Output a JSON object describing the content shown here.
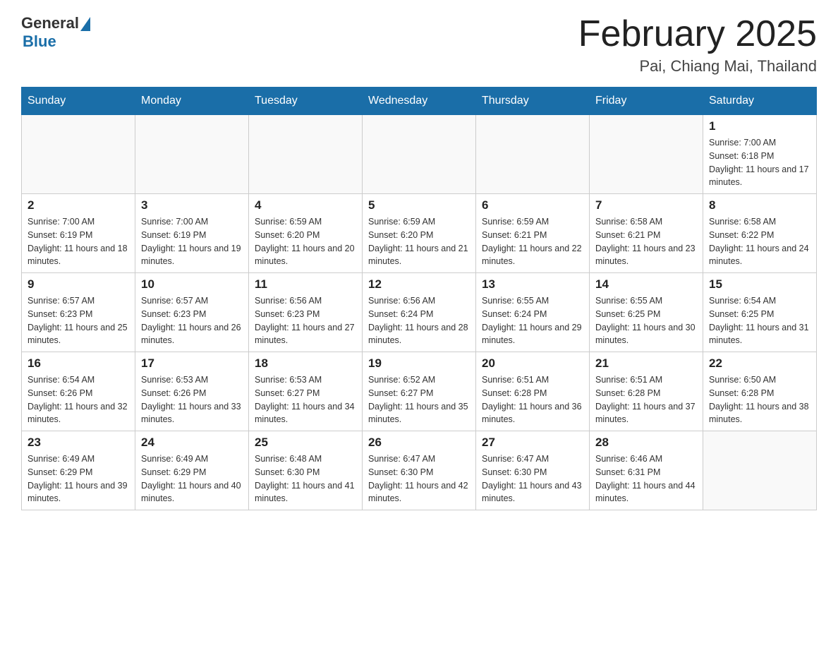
{
  "header": {
    "logo_general": "General",
    "logo_blue": "Blue",
    "month_title": "February 2025",
    "location": "Pai, Chiang Mai, Thailand"
  },
  "weekdays": [
    "Sunday",
    "Monday",
    "Tuesday",
    "Wednesday",
    "Thursday",
    "Friday",
    "Saturday"
  ],
  "weeks": [
    [
      {
        "day": "",
        "sunrise": "",
        "sunset": "",
        "daylight": ""
      },
      {
        "day": "",
        "sunrise": "",
        "sunset": "",
        "daylight": ""
      },
      {
        "day": "",
        "sunrise": "",
        "sunset": "",
        "daylight": ""
      },
      {
        "day": "",
        "sunrise": "",
        "sunset": "",
        "daylight": ""
      },
      {
        "day": "",
        "sunrise": "",
        "sunset": "",
        "daylight": ""
      },
      {
        "day": "",
        "sunrise": "",
        "sunset": "",
        "daylight": ""
      },
      {
        "day": "1",
        "sunrise": "Sunrise: 7:00 AM",
        "sunset": "Sunset: 6:18 PM",
        "daylight": "Daylight: 11 hours and 17 minutes."
      }
    ],
    [
      {
        "day": "2",
        "sunrise": "Sunrise: 7:00 AM",
        "sunset": "Sunset: 6:19 PM",
        "daylight": "Daylight: 11 hours and 18 minutes."
      },
      {
        "day": "3",
        "sunrise": "Sunrise: 7:00 AM",
        "sunset": "Sunset: 6:19 PM",
        "daylight": "Daylight: 11 hours and 19 minutes."
      },
      {
        "day": "4",
        "sunrise": "Sunrise: 6:59 AM",
        "sunset": "Sunset: 6:20 PM",
        "daylight": "Daylight: 11 hours and 20 minutes."
      },
      {
        "day": "5",
        "sunrise": "Sunrise: 6:59 AM",
        "sunset": "Sunset: 6:20 PM",
        "daylight": "Daylight: 11 hours and 21 minutes."
      },
      {
        "day": "6",
        "sunrise": "Sunrise: 6:59 AM",
        "sunset": "Sunset: 6:21 PM",
        "daylight": "Daylight: 11 hours and 22 minutes."
      },
      {
        "day": "7",
        "sunrise": "Sunrise: 6:58 AM",
        "sunset": "Sunset: 6:21 PM",
        "daylight": "Daylight: 11 hours and 23 minutes."
      },
      {
        "day": "8",
        "sunrise": "Sunrise: 6:58 AM",
        "sunset": "Sunset: 6:22 PM",
        "daylight": "Daylight: 11 hours and 24 minutes."
      }
    ],
    [
      {
        "day": "9",
        "sunrise": "Sunrise: 6:57 AM",
        "sunset": "Sunset: 6:23 PM",
        "daylight": "Daylight: 11 hours and 25 minutes."
      },
      {
        "day": "10",
        "sunrise": "Sunrise: 6:57 AM",
        "sunset": "Sunset: 6:23 PM",
        "daylight": "Daylight: 11 hours and 26 minutes."
      },
      {
        "day": "11",
        "sunrise": "Sunrise: 6:56 AM",
        "sunset": "Sunset: 6:23 PM",
        "daylight": "Daylight: 11 hours and 27 minutes."
      },
      {
        "day": "12",
        "sunrise": "Sunrise: 6:56 AM",
        "sunset": "Sunset: 6:24 PM",
        "daylight": "Daylight: 11 hours and 28 minutes."
      },
      {
        "day": "13",
        "sunrise": "Sunrise: 6:55 AM",
        "sunset": "Sunset: 6:24 PM",
        "daylight": "Daylight: 11 hours and 29 minutes."
      },
      {
        "day": "14",
        "sunrise": "Sunrise: 6:55 AM",
        "sunset": "Sunset: 6:25 PM",
        "daylight": "Daylight: 11 hours and 30 minutes."
      },
      {
        "day": "15",
        "sunrise": "Sunrise: 6:54 AM",
        "sunset": "Sunset: 6:25 PM",
        "daylight": "Daylight: 11 hours and 31 minutes."
      }
    ],
    [
      {
        "day": "16",
        "sunrise": "Sunrise: 6:54 AM",
        "sunset": "Sunset: 6:26 PM",
        "daylight": "Daylight: 11 hours and 32 minutes."
      },
      {
        "day": "17",
        "sunrise": "Sunrise: 6:53 AM",
        "sunset": "Sunset: 6:26 PM",
        "daylight": "Daylight: 11 hours and 33 minutes."
      },
      {
        "day": "18",
        "sunrise": "Sunrise: 6:53 AM",
        "sunset": "Sunset: 6:27 PM",
        "daylight": "Daylight: 11 hours and 34 minutes."
      },
      {
        "day": "19",
        "sunrise": "Sunrise: 6:52 AM",
        "sunset": "Sunset: 6:27 PM",
        "daylight": "Daylight: 11 hours and 35 minutes."
      },
      {
        "day": "20",
        "sunrise": "Sunrise: 6:51 AM",
        "sunset": "Sunset: 6:28 PM",
        "daylight": "Daylight: 11 hours and 36 minutes."
      },
      {
        "day": "21",
        "sunrise": "Sunrise: 6:51 AM",
        "sunset": "Sunset: 6:28 PM",
        "daylight": "Daylight: 11 hours and 37 minutes."
      },
      {
        "day": "22",
        "sunrise": "Sunrise: 6:50 AM",
        "sunset": "Sunset: 6:28 PM",
        "daylight": "Daylight: 11 hours and 38 minutes."
      }
    ],
    [
      {
        "day": "23",
        "sunrise": "Sunrise: 6:49 AM",
        "sunset": "Sunset: 6:29 PM",
        "daylight": "Daylight: 11 hours and 39 minutes."
      },
      {
        "day": "24",
        "sunrise": "Sunrise: 6:49 AM",
        "sunset": "Sunset: 6:29 PM",
        "daylight": "Daylight: 11 hours and 40 minutes."
      },
      {
        "day": "25",
        "sunrise": "Sunrise: 6:48 AM",
        "sunset": "Sunset: 6:30 PM",
        "daylight": "Daylight: 11 hours and 41 minutes."
      },
      {
        "day": "26",
        "sunrise": "Sunrise: 6:47 AM",
        "sunset": "Sunset: 6:30 PM",
        "daylight": "Daylight: 11 hours and 42 minutes."
      },
      {
        "day": "27",
        "sunrise": "Sunrise: 6:47 AM",
        "sunset": "Sunset: 6:30 PM",
        "daylight": "Daylight: 11 hours and 43 minutes."
      },
      {
        "day": "28",
        "sunrise": "Sunrise: 6:46 AM",
        "sunset": "Sunset: 6:31 PM",
        "daylight": "Daylight: 11 hours and 44 minutes."
      },
      {
        "day": "",
        "sunrise": "",
        "sunset": "",
        "daylight": ""
      }
    ]
  ]
}
